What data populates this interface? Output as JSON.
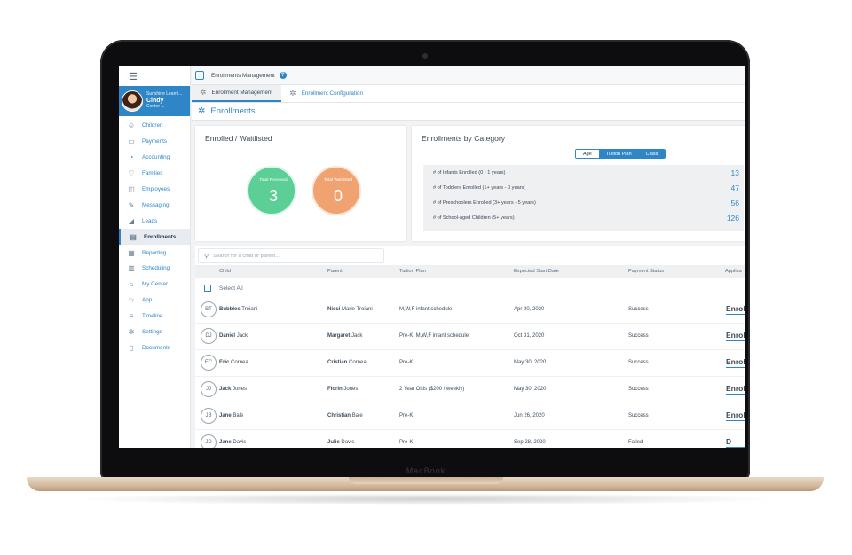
{
  "device": {
    "brand": "MacBook"
  },
  "sidebar": {
    "menu_icon": "hamburger-icon",
    "profile": {
      "org": "Sunshine Learni...",
      "name": "Cindy",
      "role": "Center"
    },
    "items": [
      {
        "label": "Children",
        "icon": "children-icon"
      },
      {
        "label": "Payments",
        "icon": "payments-icon"
      },
      {
        "label": "Accounting",
        "icon": "accounting-icon"
      },
      {
        "label": "Families",
        "icon": "families-icon"
      },
      {
        "label": "Employees",
        "icon": "employees-icon"
      },
      {
        "label": "Messaging",
        "icon": "messaging-icon"
      },
      {
        "label": "Leads",
        "icon": "leads-icon"
      },
      {
        "label": "Enrollments",
        "icon": "enrollments-icon",
        "active": true
      },
      {
        "label": "Reporting",
        "icon": "reporting-icon"
      },
      {
        "label": "Scheduling",
        "icon": "scheduling-icon"
      },
      {
        "label": "My Center",
        "icon": "center-icon"
      },
      {
        "label": "App",
        "icon": "app-icon"
      },
      {
        "label": "Timeline",
        "icon": "timeline-icon"
      },
      {
        "label": "Settings",
        "icon": "settings-icon"
      },
      {
        "label": "Documents",
        "icon": "documents-icon"
      }
    ]
  },
  "topbar": {
    "title": "Enrollments Management",
    "help": "?"
  },
  "tabs": [
    {
      "label": "Enrollment Management",
      "active": true
    },
    {
      "label": "Enrollment Configuration",
      "active": false
    }
  ],
  "page": {
    "title": "Enrollments"
  },
  "enrolled_card": {
    "title": "Enrolled / Waitlisted",
    "received_label": "Total Received",
    "received_value": "3",
    "waitlisted_label": "Total Waitlisted",
    "waitlisted_value": "0",
    "colors": {
      "received": "#5ccf96",
      "waitlisted": "#f0a271"
    }
  },
  "category_card": {
    "title": "Enrollments by Category",
    "segments": [
      {
        "label": "Age",
        "selected": true
      },
      {
        "label": "Tuition Plan",
        "selected": false
      },
      {
        "label": "Class",
        "selected": false
      }
    ],
    "rows": [
      {
        "label": "# of Infants Enrolled (0 - 1 years)",
        "value": "13"
      },
      {
        "label": "# of Toddlers Enrolled (1+ years - 3 years)",
        "value": "47"
      },
      {
        "label": "# of Preschoolers Enrolled (3+ years - 5 years)",
        "value": "56"
      },
      {
        "label": "# of School-aged Children (5+ years)",
        "value": "126"
      }
    ]
  },
  "table": {
    "search_placeholder": "Search for a child or parent...",
    "columns": [
      "Child",
      "Parent",
      "Tuition Plan",
      "Expected Start Date",
      "Payment Status",
      "Applica"
    ],
    "select_all": "Select All",
    "rows": [
      {
        "initials": "BT",
        "child_first": "Bubbles",
        "child_last": "Troiani",
        "parent_first": "Nicci",
        "parent_last": "Marie Troiani",
        "plan": "M,W,F infant schedule",
        "date": "Apr 30, 2020",
        "status": "Success",
        "action": "Enroll"
      },
      {
        "initials": "DJ",
        "child_first": "Daniel",
        "child_last": "Jack",
        "parent_first": "Margaret",
        "parent_last": "Jack",
        "plan": "Pre-K, M,W,F infant schedule",
        "date": "Oct 31, 2020",
        "status": "Success",
        "action": "Enroll"
      },
      {
        "initials": "EC",
        "child_first": "Eric",
        "child_last": "Cornea",
        "parent_first": "Cristian",
        "parent_last": "Cornea",
        "plan": "Pre-K",
        "date": "May 30, 2020",
        "status": "Success",
        "action": "Enroll"
      },
      {
        "initials": "JJ",
        "child_first": "Jack",
        "child_last": "Jones",
        "parent_first": "Florin",
        "parent_last": "Jones",
        "plan": "2 Year Olds ($200 / weekly)",
        "date": "May 30, 2020",
        "status": "Success",
        "action": "Enroll"
      },
      {
        "initials": "JB",
        "child_first": "Jane",
        "child_last": "Bale",
        "parent_first": "Christian",
        "parent_last": "Bale",
        "plan": "Pre-K",
        "date": "Jun 26, 2020",
        "status": "Success",
        "action": "Enroll"
      },
      {
        "initials": "JD",
        "child_first": "Jane",
        "child_last": "Davis",
        "parent_first": "Julie",
        "parent_last": "Davis",
        "plan": "Pre-K",
        "date": "Sep 28, 2020",
        "status": "Failed",
        "action": "D"
      }
    ]
  },
  "colors": {
    "accent": "#2f86c6"
  }
}
